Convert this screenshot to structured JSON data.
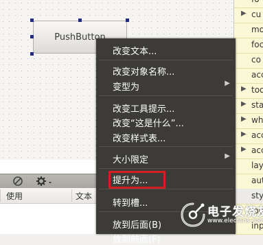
{
  "canvas": {
    "push_button": {
      "label": "PushButton"
    }
  },
  "bottom_panel": {
    "columns": [
      "使用",
      "文本"
    ]
  },
  "properties": [
    {
      "label": "fo",
      "expandable": false
    },
    {
      "label": "cu",
      "expandable": true
    },
    {
      "label": "mo",
      "expandable": false
    },
    {
      "label": "foc",
      "expandable": false
    },
    {
      "label": "co",
      "expandable": false
    },
    {
      "label": "acc",
      "expandable": false
    },
    {
      "label": "too",
      "expandable": true
    },
    {
      "label": "sta",
      "expandable": true
    },
    {
      "label": "wh",
      "expandable": true
    },
    {
      "label": "acc",
      "expandable": true
    },
    {
      "label": "acc",
      "expandable": true
    },
    {
      "label": "lay",
      "expandable": false
    },
    {
      "label": "aut",
      "expandable": false
    },
    {
      "label": "sty",
      "expandable": false
    },
    {
      "label": "loc",
      "expandable": false
    },
    {
      "label": "inp",
      "expandable": false
    }
  ],
  "context_menu": {
    "items": [
      {
        "label": "改变文本...",
        "submenu": false
      },
      {
        "label": "改变对象名称...",
        "submenu": false
      },
      {
        "label": "变型为",
        "submenu": true
      },
      {
        "label": "改变工具提示...",
        "submenu": false
      },
      {
        "label": "改变“这是什么”...",
        "submenu": false
      },
      {
        "label": "改变样式表...",
        "submenu": false
      },
      {
        "label": "大小限定",
        "submenu": true
      },
      {
        "label": "提升为...",
        "submenu": false
      },
      {
        "label": "转到槽...",
        "submenu": false,
        "highlighted": true
      },
      {
        "label": "放到后面(B)",
        "submenu": false
      },
      {
        "label": "放到前面(F)",
        "submenu": false
      }
    ]
  },
  "watermark": {
    "title": "电子发烧友",
    "url": "www.elecfans.com"
  },
  "colors": {
    "menu_bg": "#3c3b37",
    "highlight": "#d41f1f",
    "selection_handle": "#1f2a80",
    "property_bg": "#fbf8d6"
  }
}
